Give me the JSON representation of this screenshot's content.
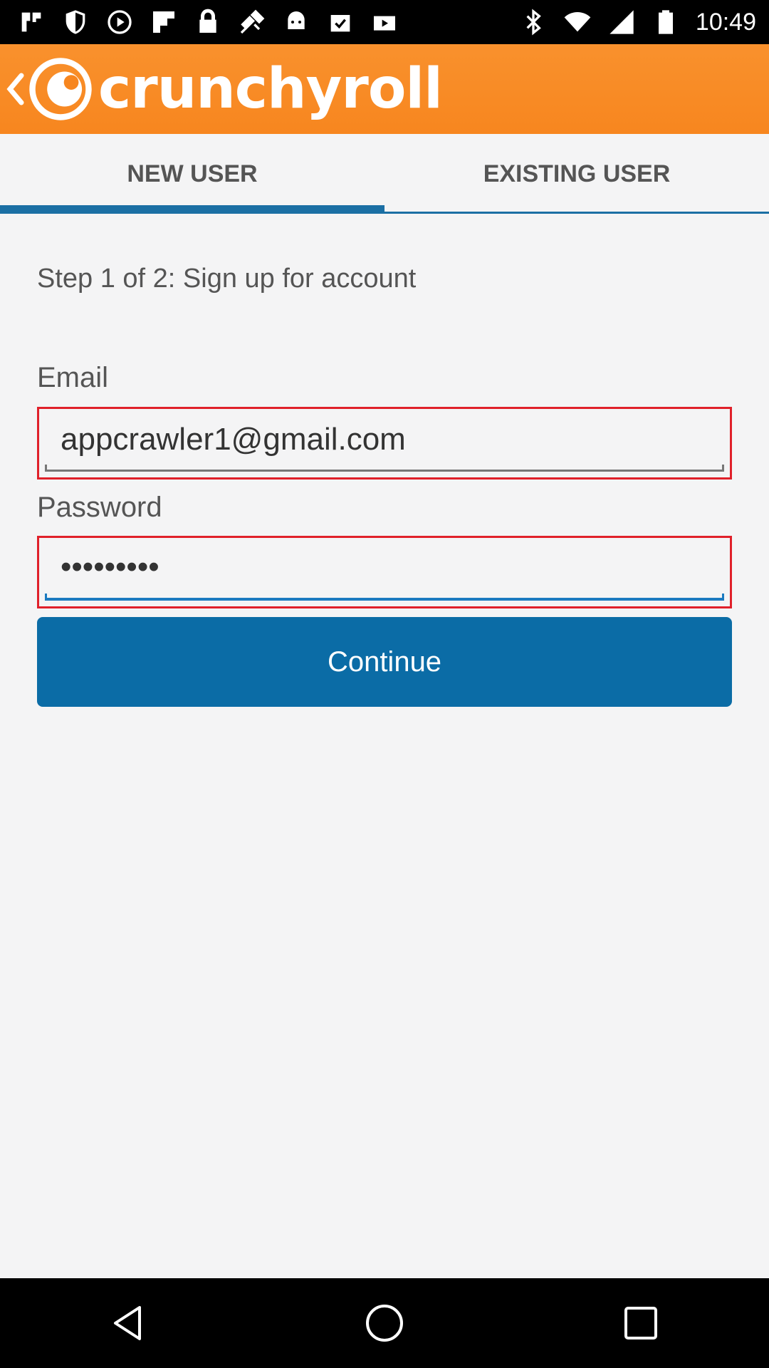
{
  "status_bar": {
    "time": "10:49",
    "left_icons": [
      "notification-icon",
      "shield-icon",
      "play-icon",
      "flipboard-icon",
      "lock-icon",
      "satellite-icon",
      "android-icon",
      "checkbox-icon",
      "youtube-icon"
    ],
    "right_icons": [
      "bluetooth-icon",
      "wifi-icon",
      "signal-icon",
      "battery-icon"
    ]
  },
  "app_bar": {
    "brand": "crunchyroll",
    "color": "#f7861f"
  },
  "tabs": [
    {
      "label": "NEW USER",
      "active": true
    },
    {
      "label": "EXISTING USER",
      "active": false
    }
  ],
  "form": {
    "step_text": "Step 1 of 2: Sign up for account",
    "email_label": "Email",
    "email_value": "appcrawler1@gmail.com",
    "password_label": "Password",
    "password_value": "•••••••••",
    "continue_label": "Continue"
  },
  "colors": {
    "accent": "#0b6ca6",
    "highlight": "#e0202a"
  }
}
